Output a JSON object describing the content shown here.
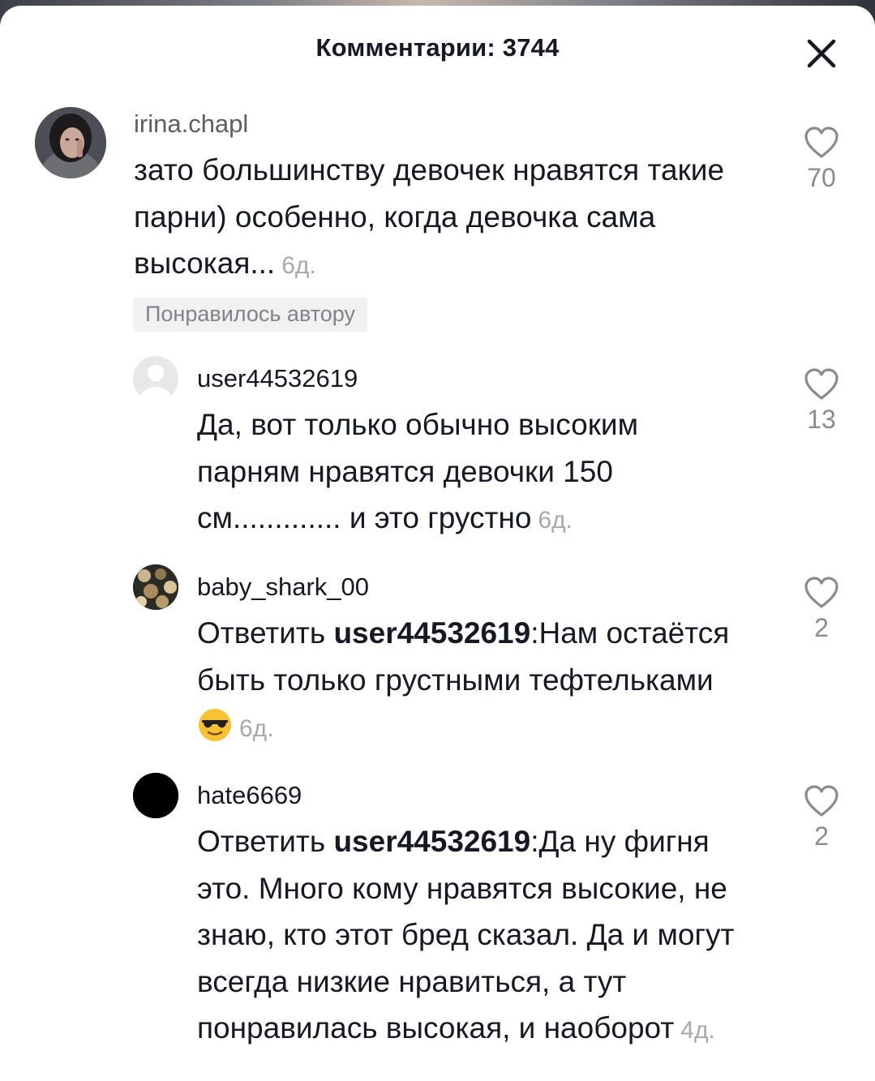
{
  "header": {
    "title": "Комментарии: 3744",
    "close_icon": "close-icon"
  },
  "colors": {
    "text": "#161823",
    "secondary": "#8a8b91",
    "badge_bg": "#f1f1f2"
  },
  "comments": [
    {
      "username": "irina.chapl",
      "text": "зато большинству девочек нравятся такие парни) особенно, когда девочка сама высокая...",
      "time": "6д.",
      "badge": "Понравилось автору",
      "likes": "70",
      "avatar_icon": "profile-photo"
    },
    {
      "username": "user44532619",
      "text": "Да, вот только обычно высоким парням нравятся девочки 150 см............. и это грустно",
      "time": "6д.",
      "likes": "13",
      "avatar_icon": "default-avatar-icon"
    },
    {
      "username": "baby_shark_00",
      "reply_prefix": "Ответить ",
      "mention": "user44532619",
      "text": ":Нам остаётся быть только грустными тефтельками",
      "emoji": "sunglasses-emoji",
      "time": "6д.",
      "likes": "2",
      "avatar_icon": "profile-photo"
    },
    {
      "username": "hate6669",
      "reply_prefix": "Ответить ",
      "mention": "user44532619",
      "text": ":Да ну фигня это. Много кому нравятся высокие, не знаю, кто этот бред сказал. Да и могут всегда низкие нравиться, а тут понравилась высокая, и наоборот",
      "time": "4д.",
      "likes": "2",
      "avatar_icon": "black-avatar"
    }
  ]
}
